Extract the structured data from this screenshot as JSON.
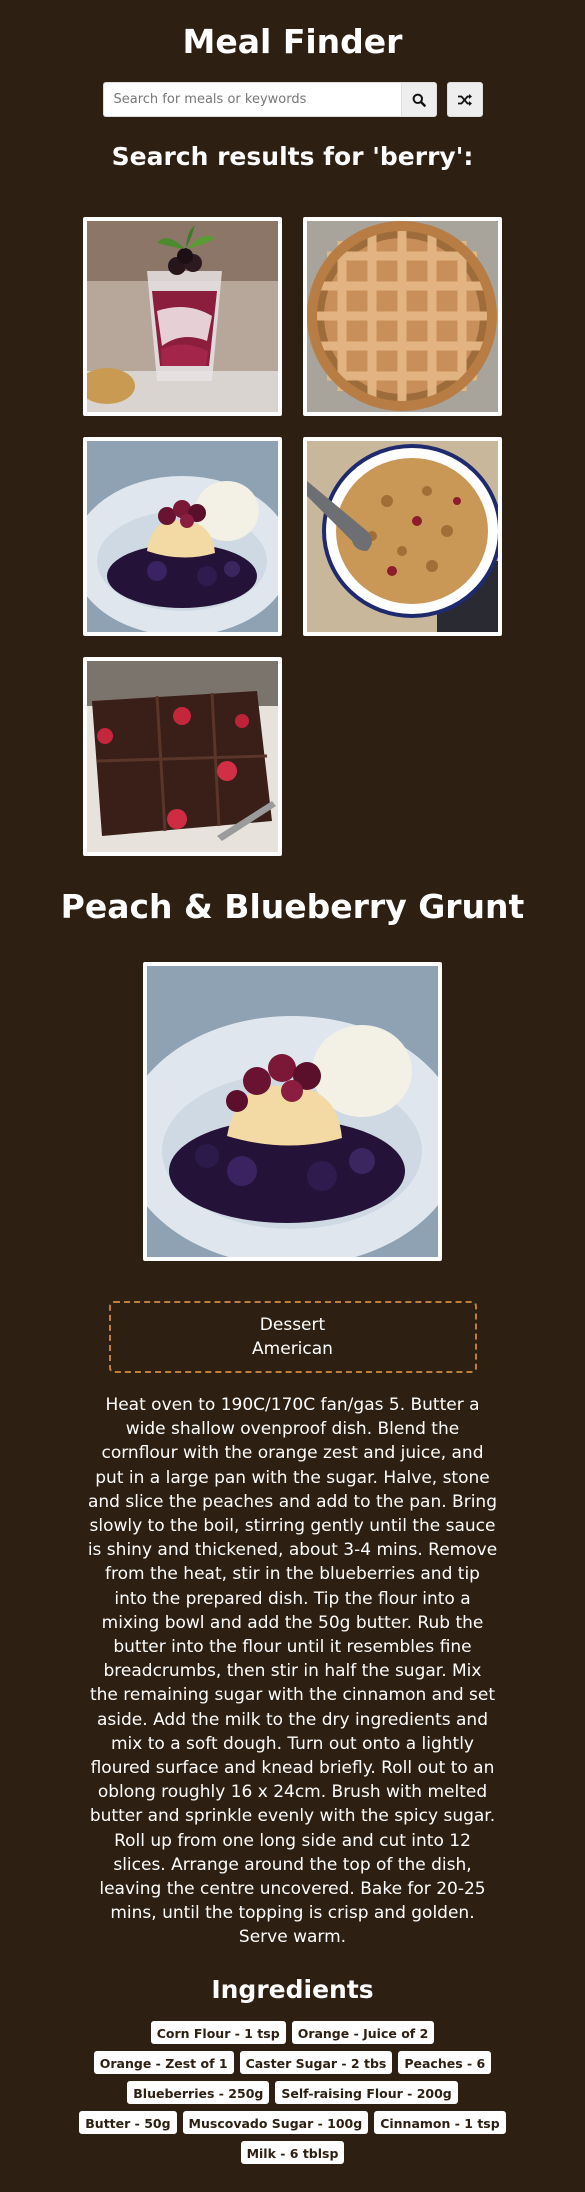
{
  "app": {
    "title": "Meal Finder"
  },
  "search": {
    "placeholder": "Search for meals or keywords",
    "value": "",
    "search_icon": "search-icon",
    "random_icon": "shuffle-icon"
  },
  "results": {
    "heading": "Search results for 'berry':",
    "meals": [
      {
        "photo": "berry-dessert-glass"
      },
      {
        "photo": "lattice-pie"
      },
      {
        "photo": "blueberry-grunt-bowl"
      },
      {
        "photo": "fruit-crumble-dish"
      },
      {
        "photo": "brownie-with-raspberries"
      }
    ]
  },
  "meal": {
    "name": "Peach & Blueberry Grunt",
    "category": "Dessert",
    "area": "American",
    "instructions": "Heat oven to 190C/170C fan/gas 5. Butter a wide shallow ovenproof dish. Blend the cornflour with the orange zest and juice, and put in a large pan with the sugar. Halve, stone and slice the peaches and add to the pan. Bring slowly to the boil, stirring gently until the sauce is shiny and thickened, about 3-4 mins. Remove from the heat, stir in the blueberries and tip into the prepared dish. Tip the flour into a mixing bowl and add the 50g butter. Rub the butter into the flour until it resembles fine breadcrumbs, then stir in half the sugar. Mix the remaining sugar with the cinnamon and set aside. Add the milk to the dry ingredients and mix to a soft dough. Turn out onto a lightly floured surface and knead briefly. Roll out to an oblong roughly 16 x 24cm. Brush with melted butter and sprinkle evenly with the spicy sugar. Roll up from one long side and cut into 12 slices. Arrange around the top of the dish, leaving the centre uncovered. Bake for 20-25 mins, until the topping is crisp and golden. Serve warm.",
    "ingredients_heading": "Ingredients",
    "ingredients": [
      "Corn Flour - 1 tsp",
      "Orange - Juice of 2",
      "Orange - Zest of 1",
      "Caster Sugar - 2 tbs",
      "Peaches - 6",
      "Blueberries - 250g",
      "Self-raising Flour - 200g",
      "Butter - 50g",
      "Muscovado Sugar - 100g",
      "Cinnamon - 1 tsp",
      "Milk - 6 tblsp"
    ]
  },
  "colors": {
    "background": "#2d2013",
    "accent_border": "#c0803a",
    "text": "#ffffff"
  }
}
